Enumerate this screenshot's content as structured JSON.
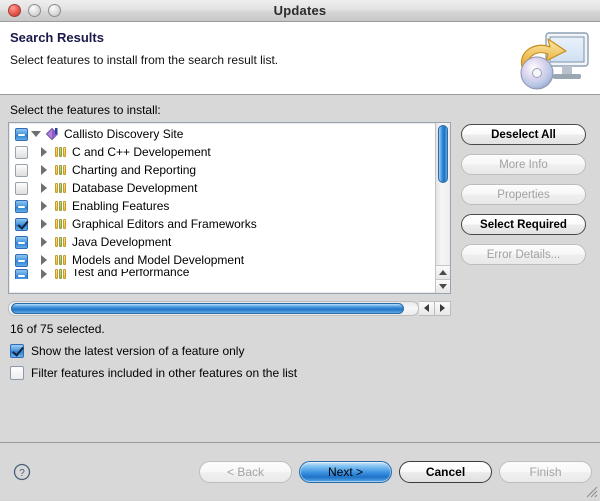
{
  "window": {
    "title": "Updates",
    "controls": [
      "close-button",
      "minimize-button",
      "zoom-button"
    ]
  },
  "header": {
    "title": "Search Results",
    "subtitle": "Select features to install from the search result list.",
    "icon": "install-computer-cd-icon"
  },
  "main": {
    "tree_label": "Select the features to install:",
    "tree": {
      "root": {
        "label": "Callisto Discovery Site",
        "checkbox_state": "partial",
        "twisty": "expanded",
        "icon": "discovery-site-icon"
      },
      "items": [
        {
          "label": "C and C++ Developement",
          "checkbox_state": "unchecked",
          "twisty": "collapsed",
          "icon": "feature-icon"
        },
        {
          "label": "Charting and Reporting",
          "checkbox_state": "unchecked",
          "twisty": "collapsed",
          "icon": "feature-icon"
        },
        {
          "label": "Database Development",
          "checkbox_state": "unchecked",
          "twisty": "collapsed",
          "icon": "feature-icon"
        },
        {
          "label": "Enabling Features",
          "checkbox_state": "partial",
          "twisty": "collapsed",
          "icon": "feature-icon"
        },
        {
          "label": "Graphical Editors and Frameworks",
          "checkbox_state": "checked",
          "twisty": "collapsed",
          "icon": "feature-icon"
        },
        {
          "label": "Java Development",
          "checkbox_state": "partial",
          "twisty": "collapsed",
          "icon": "feature-icon"
        },
        {
          "label": "Models and Model Development",
          "checkbox_state": "partial",
          "twisty": "collapsed",
          "icon": "feature-icon"
        },
        {
          "label": "Test and Performance",
          "checkbox_state": "partial",
          "twisty": "collapsed",
          "icon": "feature-icon"
        }
      ]
    },
    "side_buttons": [
      {
        "label": "Deselect All",
        "enabled": true
      },
      {
        "label": "More Info",
        "enabled": false
      },
      {
        "label": "Properties",
        "enabled": false
      },
      {
        "label": "Select Required",
        "enabled": true
      },
      {
        "label": "Error Details...",
        "enabled": false
      }
    ],
    "status": "16 of 75 selected.",
    "options": [
      {
        "label": "Show the latest version of a feature only",
        "checked": true
      },
      {
        "label": "Filter features included in other features on the list",
        "checked": false
      }
    ]
  },
  "footer": {
    "help_icon": "help-question-icon",
    "buttons": [
      {
        "label": "< Back",
        "enabled": false,
        "primary": false
      },
      {
        "label": "Next >",
        "enabled": true,
        "primary": true
      },
      {
        "label": "Cancel",
        "enabled": true,
        "primary": false
      },
      {
        "label": "Finish",
        "enabled": false,
        "primary": false
      }
    ]
  },
  "colors": {
    "accent_blue": "#2f7fd0",
    "window_bg": "#d8d8d8",
    "header_bg": "#ffffff",
    "title_text": "#2b2b2b",
    "heading_text": "#1a1a4a",
    "close_red": "#e8584d"
  }
}
